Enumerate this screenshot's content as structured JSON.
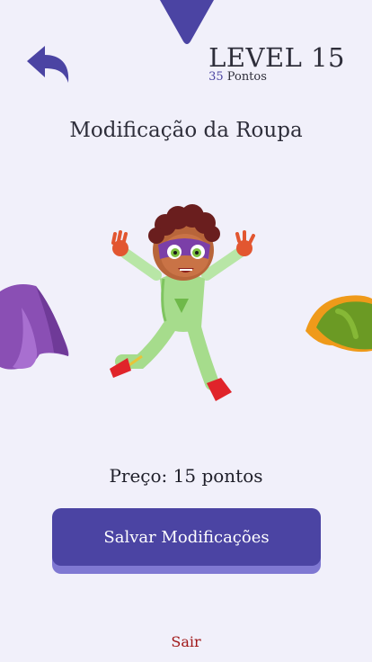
{
  "header": {
    "level_label": "LEVEL 15",
    "points_value": "35",
    "points_unit": "Pontos",
    "back_icon": "back-arrow-icon"
  },
  "page": {
    "title": "Modificação da Roupa"
  },
  "carousel": {
    "left_item": "purple-cape",
    "center_item": "superhero-character",
    "right_item": "green-orange-cape"
  },
  "shop": {
    "price_label": "Preço: 15 pontos",
    "save_label": "Salvar Modificações",
    "exit_label": "Sair"
  },
  "colors": {
    "accent": "#4b44a3",
    "accent_shadow": "#7f78d2",
    "background": "#f1f0fa",
    "exit": "#a01717"
  }
}
